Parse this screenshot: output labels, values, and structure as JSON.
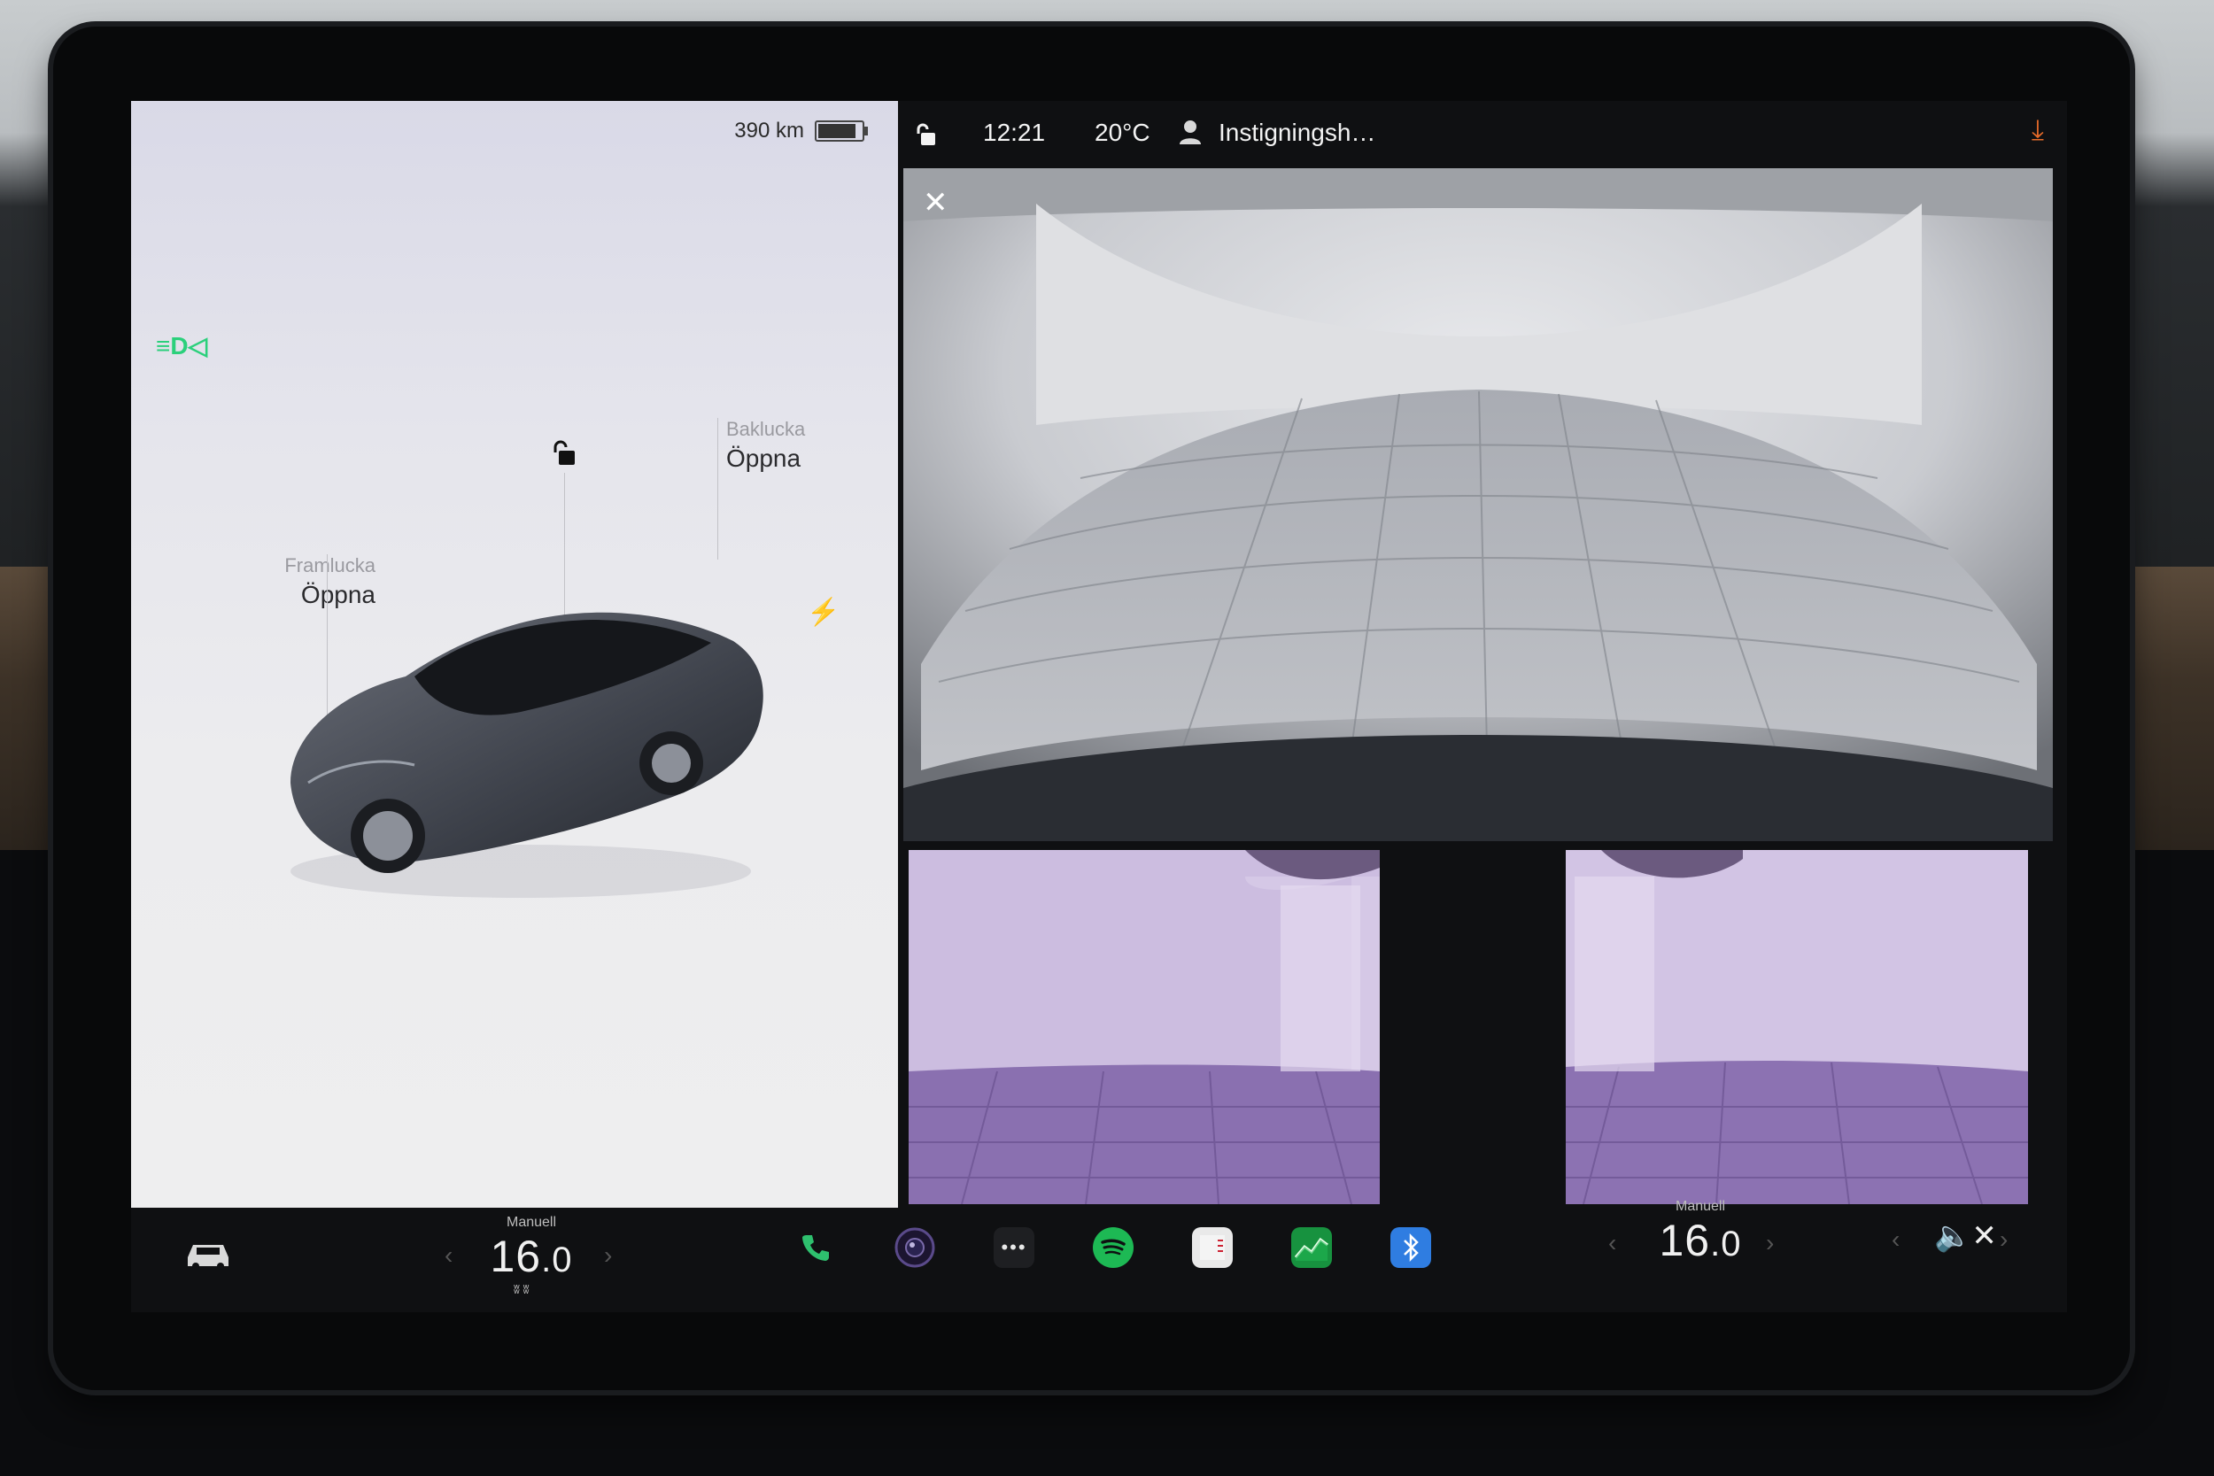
{
  "car": {
    "range": "390 km",
    "battery_level": 0.8,
    "front_trunk_label": "Framlucka",
    "front_trunk_action": "Öppna",
    "rear_trunk_label": "Baklucka",
    "rear_trunk_action": "Öppna",
    "icons": [
      "headlight-icon",
      "unlock-icon",
      "charge-bolt-icon"
    ]
  },
  "status": {
    "time": "12:21",
    "temperature": "20°C",
    "profile": "Instigningsh…",
    "accent": "#e66b2a"
  },
  "cameras": {
    "close_label": "✕"
  },
  "dock": {
    "left_climate": {
      "mode": "Manuell",
      "whole": "16",
      "decimal": ".0"
    },
    "right_climate": {
      "mode": "Manuell",
      "whole": "16",
      "decimal": ".0"
    },
    "icons": [
      "car-icon",
      "phone-icon",
      "camera-icon",
      "more-icon",
      "spotify-icon",
      "calendar-icon",
      "energy-icon",
      "bluetooth-icon",
      "mute-icon"
    ]
  }
}
